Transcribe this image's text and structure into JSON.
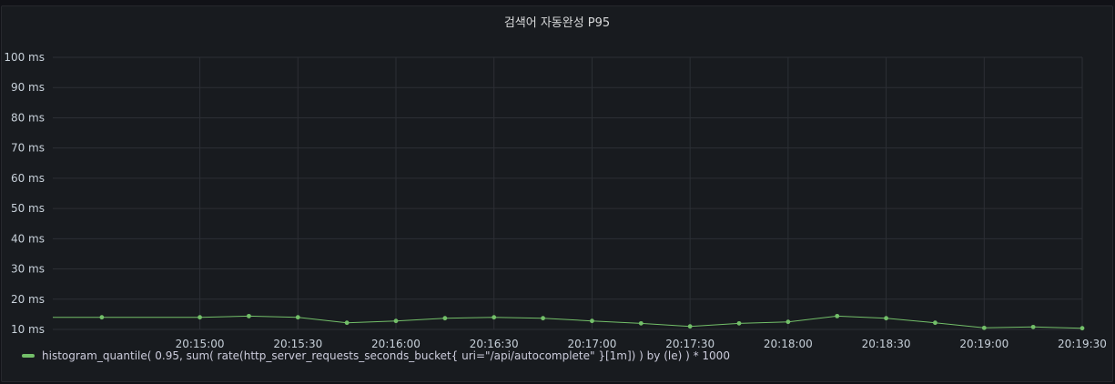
{
  "panel": {
    "title": "검색어 자동완성 P95"
  },
  "colors": {
    "background": "#111217",
    "panel": "#181b1f",
    "grid": "#2c2f35",
    "series": "#73bf69",
    "text": "#c7d0d9"
  },
  "chart_data": {
    "type": "line",
    "title": "검색어 자동완성 P95",
    "xlabel": "",
    "ylabel": "",
    "unit": "ms",
    "ylim": [
      10,
      100
    ],
    "y_ticks": [
      10,
      20,
      30,
      40,
      50,
      60,
      70,
      80,
      90,
      100
    ],
    "y_tick_labels": [
      "10 ms",
      "20 ms",
      "30 ms",
      "40 ms",
      "50 ms",
      "60 ms",
      "70 ms",
      "80 ms",
      "90 ms",
      "100 ms"
    ],
    "x_range": [
      "20:14:15",
      "20:19:30"
    ],
    "x_ticks": [
      "20:15:00",
      "20:15:30",
      "20:16:00",
      "20:16:30",
      "20:17:00",
      "20:17:30",
      "20:18:00",
      "20:18:30",
      "20:19:00",
      "20:19:30"
    ],
    "grid": true,
    "legend_position": "bottom-left",
    "series": [
      {
        "name": "histogram_quantile( 0.95, sum( rate(http_server_requests_seconds_bucket{ uri=\"/api/autocomplete\" }[1m]) ) by (le) ) * 1000",
        "color": "#73bf69",
        "x": [
          "20:14:15",
          "20:14:30",
          "20:15:00",
          "20:15:15",
          "20:15:30",
          "20:15:45",
          "20:16:00",
          "20:16:15",
          "20:16:30",
          "20:16:45",
          "20:17:00",
          "20:17:15",
          "20:17:30",
          "20:17:45",
          "20:18:00",
          "20:18:15",
          "20:18:30",
          "20:18:45",
          "20:19:00",
          "20:19:15",
          "20:19:30"
        ],
        "values": [
          14.0,
          14.0,
          14.0,
          14.4,
          14.0,
          12.2,
          12.8,
          13.7,
          14.0,
          13.7,
          12.8,
          12.0,
          11.0,
          12.0,
          12.5,
          14.4,
          13.7,
          12.2,
          10.5,
          10.8,
          10.4
        ],
        "markers": [
          false,
          true,
          true,
          true,
          true,
          true,
          true,
          true,
          true,
          true,
          true,
          true,
          true,
          true,
          true,
          true,
          true,
          true,
          true,
          true,
          true
        ]
      }
    ]
  }
}
